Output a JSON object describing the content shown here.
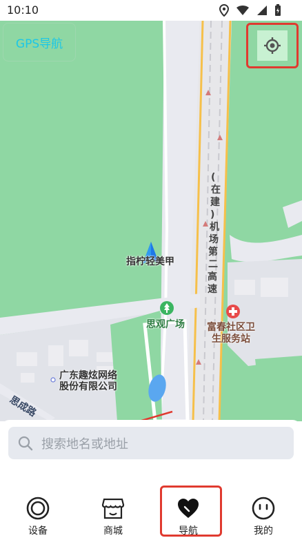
{
  "status_bar": {
    "time": "10:10"
  },
  "app_badge": {
    "title": "GPS导航"
  },
  "map": {
    "poi_labels": {
      "user_location": "指柠轻美甲",
      "square": "思观广场",
      "clinic_line1": "富春社区卫",
      "clinic_line2": "生服务站",
      "company_line1": "广东趣炫网络",
      "company_line2": "股份有限公司"
    },
    "road_labels": {
      "expressway": [
        "(",
        "在",
        "建",
        ")",
        "机",
        "场",
        "第",
        "二",
        "高",
        "速"
      ],
      "side_road": "思成路"
    }
  },
  "search": {
    "placeholder": "搜索地名或地址"
  },
  "tabs": [
    {
      "label": "设备",
      "icon": "target-ring-icon"
    },
    {
      "label": "商城",
      "icon": "shop-icon"
    },
    {
      "label": "导航",
      "icon": "navigation-heart-icon"
    },
    {
      "label": "我的",
      "icon": "profile-face-icon"
    }
  ],
  "colors": {
    "map_green": "#8fd7a3",
    "road_gray": "#e9eaf0",
    "expressway_yellow": "#f6c04a",
    "annotation_red": "#e03a2f",
    "badge_text": "#1cc7e6"
  }
}
